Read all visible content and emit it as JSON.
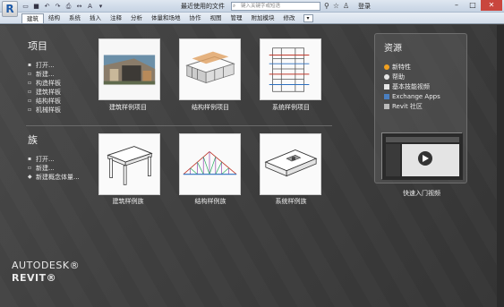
{
  "titlebar": {
    "app_button": "R",
    "title": "最近使用的文件",
    "search_placeholder": "键入关键字或短语",
    "login": "登录"
  },
  "ribbon": {
    "tabs": [
      "建筑",
      "结构",
      "系统",
      "插入",
      "注释",
      "分析",
      "体量和场地",
      "协作",
      "视图",
      "管理",
      "附加模块",
      "修改"
    ],
    "toggle": "▾"
  },
  "projects": {
    "title": "项目",
    "links": [
      "打开...",
      "新建...",
      "构造样板",
      "建筑样板",
      "结构样板",
      "机械样板"
    ],
    "thumbs": [
      "建筑样例项目",
      "结构样例项目",
      "系统样例项目"
    ]
  },
  "families": {
    "title": "族",
    "links": [
      "打开...",
      "新建...",
      "新建概念体量..."
    ],
    "thumbs": [
      "建筑样例族",
      "结构样例族",
      "系统样例族"
    ]
  },
  "resources": {
    "title": "资源",
    "items": [
      "新特性",
      "帮助",
      "基本技能视频",
      "Exchange Apps",
      "Revit 社区"
    ],
    "video_caption": "快速入门视频"
  },
  "brand": {
    "line1": "AUTODESK®",
    "line2": "REVIT®"
  },
  "colors": {
    "background": "#3c3c3c",
    "new_features_dot": "#f0a020"
  }
}
